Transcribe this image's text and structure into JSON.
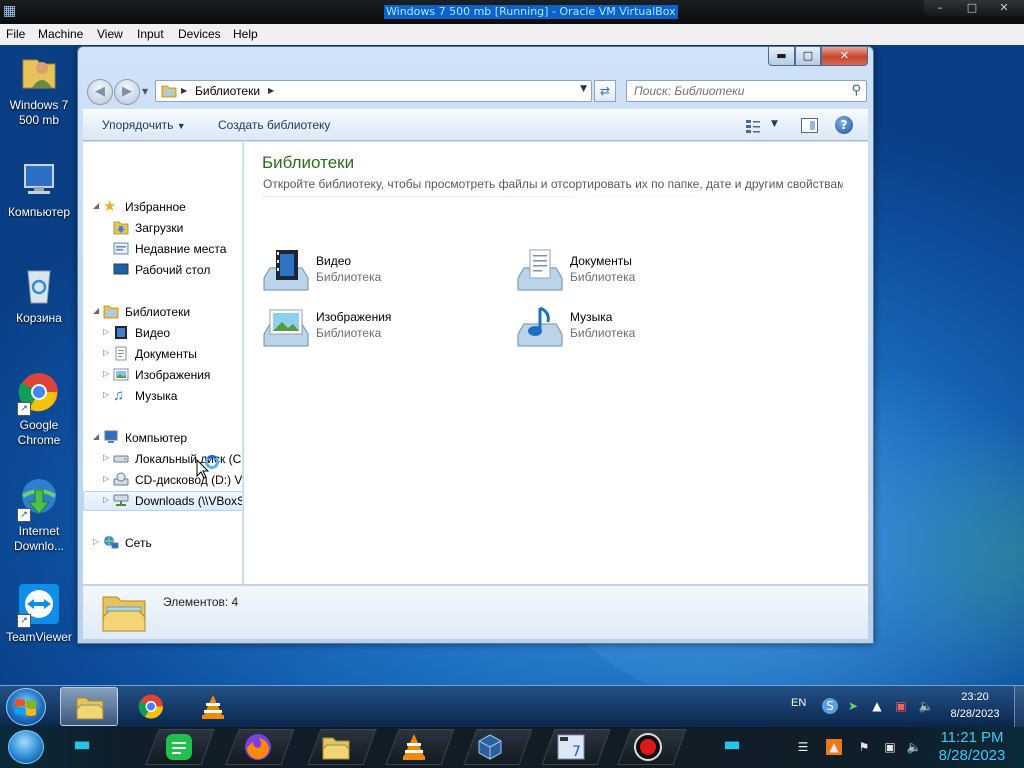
{
  "host": {
    "title": "Windows 7 500 mb [Running] - Oracle VM VirtualBox",
    "menu": [
      "File",
      "Machine",
      "View",
      "Input",
      "Devices",
      "Help"
    ]
  },
  "desktop": {
    "icons": [
      {
        "label": "Windows 7 500 mb",
        "icon": "user-folder-icon",
        "shortcut": false
      },
      {
        "label": "Компьютер",
        "icon": "computer-icon",
        "shortcut": false
      },
      {
        "label": "Корзина",
        "icon": "recycle-bin-icon",
        "shortcut": false
      },
      {
        "label": "Google Chrome",
        "icon": "chrome-icon",
        "shortcut": true
      },
      {
        "label": "Internet Downlo...",
        "icon": "internet-download-manager-icon",
        "shortcut": true
      },
      {
        "label": "TeamViewer",
        "icon": "teamviewer-icon",
        "shortcut": true
      }
    ]
  },
  "explorer": {
    "address": "Библиотеки",
    "search_placeholder": "Поиск: Библиотеки",
    "commands": {
      "organize": "Упорядочить",
      "create_library": "Создать библиотеку"
    },
    "nav": {
      "favorites": "Избранное",
      "downloads": "Загрузки",
      "recent": "Недавние места",
      "desktop": "Рабочий стол",
      "libraries": "Библиотеки",
      "video": "Видео",
      "documents": "Документы",
      "images": "Изображения",
      "music": "Музыка",
      "computer": "Компьютер",
      "local_disk": "Локальный диск (C:)",
      "cd_drive": "CD-дисковод (D:) VirtualBox",
      "network_share": "Downloads (\\\\VBoxSvr)",
      "network": "Сеть"
    },
    "content": {
      "title": "Библиотеки",
      "description": "Откройте библиотеку, чтобы просмотреть файлы и отсортировать их по папке, дате и другим свойствам.",
      "libraries": [
        {
          "name": "Видео",
          "type": "Библиотека",
          "icon": "video-library-icon"
        },
        {
          "name": "Документы",
          "type": "Библиотека",
          "icon": "documents-library-icon"
        },
        {
          "name": "Изображения",
          "type": "Библиотека",
          "icon": "pictures-library-icon"
        },
        {
          "name": "Музыка",
          "type": "Библиотека",
          "icon": "music-library-icon"
        }
      ]
    },
    "details": "Элементов: 4"
  },
  "taskbar": {
    "lang": "EN",
    "time": "23:20",
    "date": "8/28/2023"
  },
  "dock": {
    "time": "11:21 PM",
    "date": "8/28/2023"
  },
  "colors": {
    "accent": "#1c6ec0",
    "library_title": "#2a6d1e",
    "close_red": "#c7442c"
  }
}
